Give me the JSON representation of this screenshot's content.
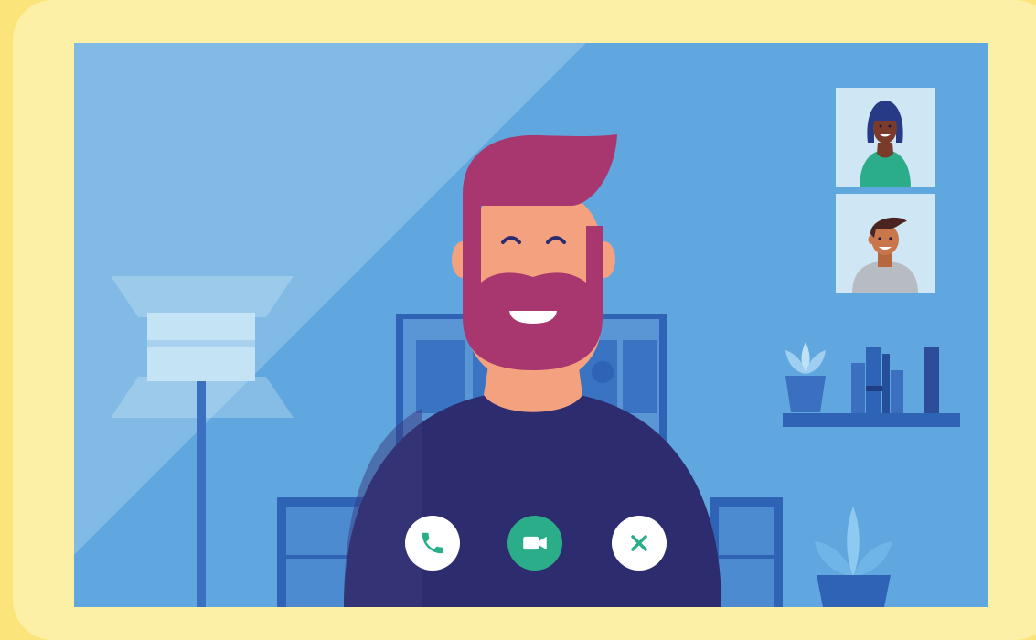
{
  "app": {
    "type": "video-call"
  },
  "participants": [
    {
      "role": "main-speaker"
    },
    {
      "role": "thumbnail-participant-1"
    },
    {
      "role": "thumbnail-participant-2"
    }
  ],
  "controls": [
    {
      "name": "answer-call-button",
      "icon": "phone-icon"
    },
    {
      "name": "video-toggle-button",
      "icon": "video-camera-icon"
    },
    {
      "name": "end-call-button",
      "icon": "close-icon"
    }
  ],
  "colors": {
    "frame": "#fbf0a5",
    "background": "#fbe57a",
    "screen": "#5fa7de",
    "phone_green": "#2bad8a",
    "hair_magenta": "#a7376e",
    "shirt_navy": "#2c2c6e"
  }
}
